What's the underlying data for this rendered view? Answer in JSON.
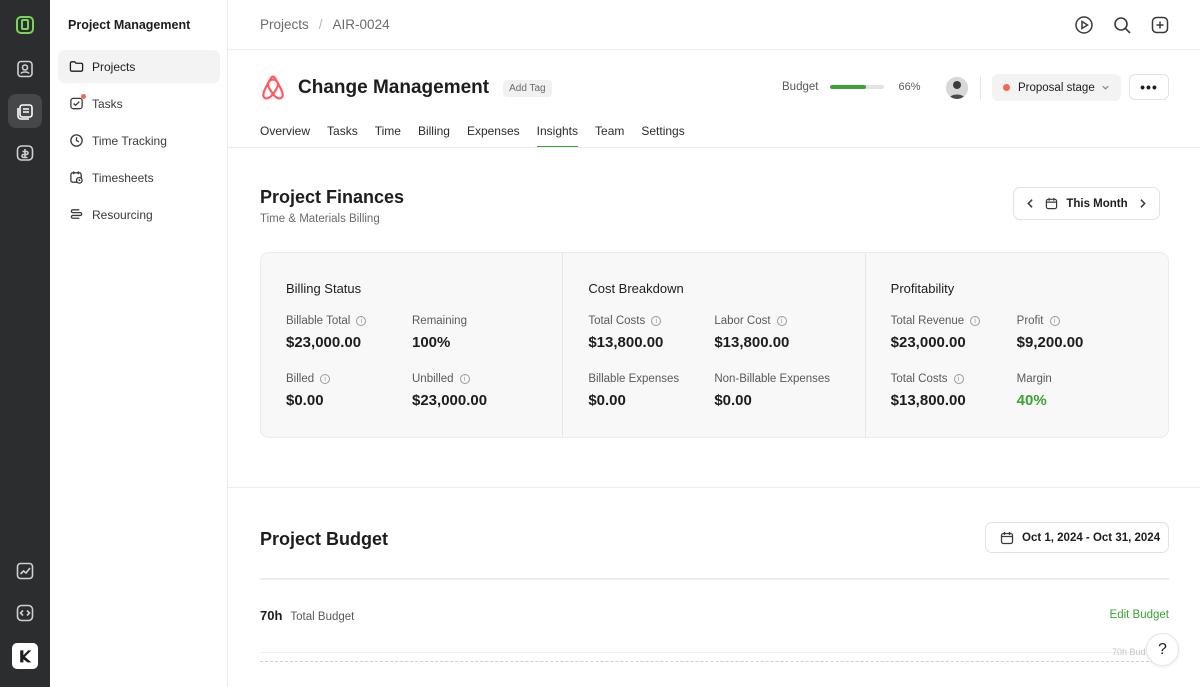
{
  "sidebar": {
    "title": "Project Management",
    "items": [
      {
        "label": "Projects",
        "icon": "folder-icon"
      },
      {
        "label": "Tasks",
        "icon": "task-check-icon"
      },
      {
        "label": "Time Tracking",
        "icon": "clock-icon"
      },
      {
        "label": "Timesheets",
        "icon": "calendar-clock-icon"
      },
      {
        "label": "Resourcing",
        "icon": "stack-icon"
      }
    ]
  },
  "breadcrumb": {
    "root": "Projects",
    "separator": "/",
    "current": "AIR-0024"
  },
  "project": {
    "title": "Change Management",
    "add_tag": "Add Tag",
    "budget_label": "Budget",
    "budget_progress": 0.66,
    "budget_pct": "66%",
    "stage": "Proposal stage",
    "more": "•••"
  },
  "tabs": [
    "Overview",
    "Tasks",
    "Time",
    "Billing",
    "Expenses",
    "Insights",
    "Team",
    "Settings"
  ],
  "active_tab": "Insights",
  "finances": {
    "title": "Project Finances",
    "subtitle": "Time & Materials Billing",
    "period": "This Month",
    "cards": [
      {
        "title": "Billing Status",
        "metrics": [
          {
            "label": "Billable Total",
            "value": "$23,000.00",
            "info": true
          },
          {
            "label": "Remaining",
            "value": "100%",
            "info": false
          },
          {
            "label": "Billed",
            "value": "$0.00",
            "info": true
          },
          {
            "label": "Unbilled",
            "value": "$23,000.00",
            "info": true
          }
        ]
      },
      {
        "title": "Cost Breakdown",
        "metrics": [
          {
            "label": "Total Costs",
            "value": "$13,800.00",
            "info": true
          },
          {
            "label": "Labor Cost",
            "value": "$13,800.00",
            "info": true
          },
          {
            "label": "Billable Expenses",
            "value": "$0.00",
            "info": false
          },
          {
            "label": "Non-Billable Expenses",
            "value": "$0.00",
            "info": false
          }
        ]
      },
      {
        "title": "Profitability",
        "metrics": [
          {
            "label": "Total Revenue",
            "value": "$23,000.00",
            "info": true
          },
          {
            "label": "Profit",
            "value": "$9,200.00",
            "info": true
          },
          {
            "label": "Total Costs",
            "value": "$13,800.00",
            "info": true
          },
          {
            "label": "Margin",
            "value": "40%",
            "info": false
          }
        ]
      }
    ]
  },
  "budget_section": {
    "title": "Project Budget",
    "date_range": "Oct 1, 2024 - Oct 31, 2024",
    "total_value": "70h",
    "total_label": "Total Budget",
    "edit_label": "Edit Budget",
    "faded_label": "70h Bud"
  },
  "help": "?",
  "colors": {
    "accent": "#3aa335",
    "stage_dot": "#f2694f",
    "brand": "#ff5a5f",
    "rail": "#2b2d2f"
  }
}
